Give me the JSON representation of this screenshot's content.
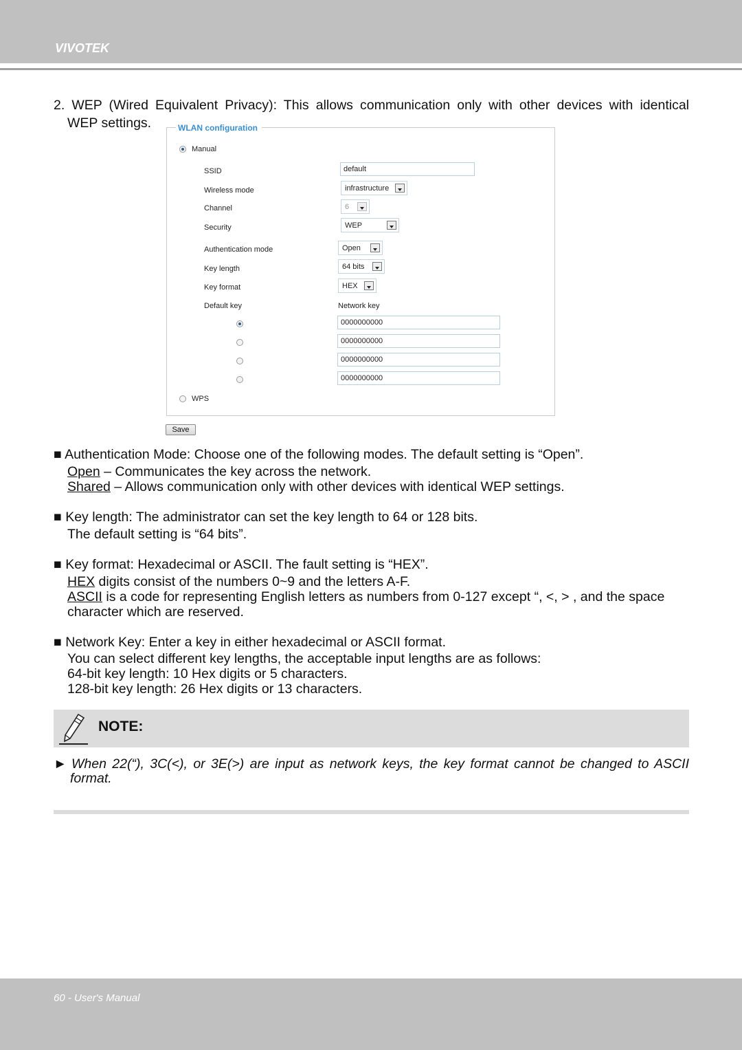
{
  "header": {
    "brand": "VIVOTEK"
  },
  "intro": {
    "line1": "2.  WEP (Wired Equivalent Privacy): This allows communication only with other devices with identical",
    "line2": "WEP settings."
  },
  "wlan": {
    "title": "WLAN configuration",
    "manual": "Manual",
    "wps": "WPS",
    "fields": [
      {
        "label": "SSID",
        "value": "default"
      },
      {
        "label": "Wireless mode",
        "value": "infrastructure"
      },
      {
        "label": "Channel",
        "value": "6"
      },
      {
        "label": "Security",
        "value": "WEP"
      },
      {
        "label": "Authentication mode",
        "value": "Open"
      },
      {
        "label": "Key length",
        "value": "64 bits"
      },
      {
        "label": "Key format",
        "value": "HEX"
      }
    ],
    "default_key_label": "Default key",
    "network_key_label": "Network key",
    "keys": [
      "0000000000",
      "0000000000",
      "0000000000",
      "0000000000"
    ],
    "selected_key": 1,
    "save": "Save"
  },
  "bullets": {
    "auth": {
      "l1": "Authentication Mode: Choose one of the following modes. The default setting is “Open”.",
      "open": "Open",
      "open_desc": " – Communicates the key across the network.",
      "shared": "Shared",
      "shared_desc": " – Allows communication only with other devices with identical WEP settings."
    },
    "keylen": {
      "l1": "Key length: The administrator can set the key length to 64 or 128 bits.",
      "l2": "The default setting is “64 bits”."
    },
    "keyfmt": {
      "l1": "Key format: Hexadecimal or ASCII. The fault setting is “HEX”.",
      "hex": "HEX",
      "hex_desc": " digits consist of the numbers 0~9 and the letters A-F.",
      "ascii": "ASCII",
      "ascii_desc": " is a code for representing English letters as numbers from 0-127 except “, <, > , and the space",
      "l4": "character which are reserved."
    },
    "netkey": {
      "l1": "Network Key: Enter a key in either hexadecimal or ASCII format.",
      "l2": "You can select different key lengths, the acceptable input lengths are as follows:",
      "l3": "64-bit key length: 10 Hex digits or 5 characters.",
      "l4": "128-bit key length: 26 Hex digits or 13 characters."
    }
  },
  "note": {
    "title": "NOTE:",
    "l1": "When 22(“), 3C(<), or 3E(>) are input as network keys, the key format cannot be changed to ASCII",
    "l2": "format."
  },
  "footer": {
    "page": "60 - User's Manual"
  }
}
